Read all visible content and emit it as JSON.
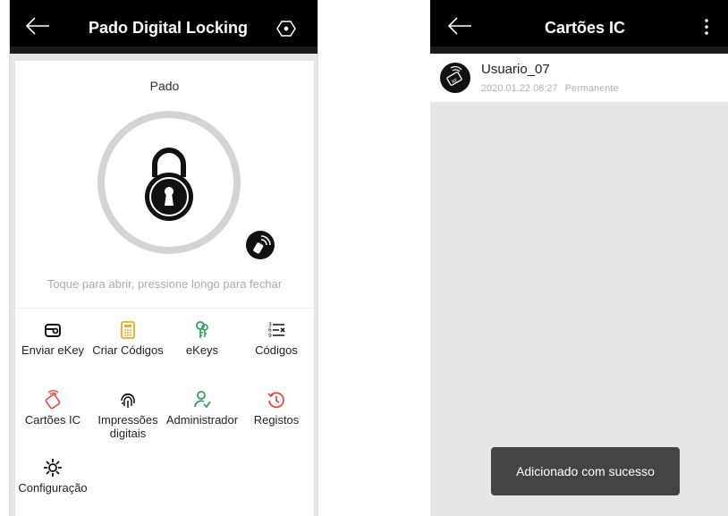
{
  "left": {
    "title": "Pado Digital Locking",
    "lock_name": "Pado",
    "hint": "Toque para abrir, pressione longo para fechar",
    "menu": [
      {
        "label": "Enviar eKey",
        "icon": "send-ekey-icon",
        "color": "#111111"
      },
      {
        "label": "Criar Códigos",
        "icon": "create-codes-icon",
        "color": "#f5a623"
      },
      {
        "label": "eKeys",
        "icon": "ekeys-icon",
        "color": "#2e9e5b"
      },
      {
        "label": "Códigos",
        "icon": "codes-icon",
        "color": "#111111"
      },
      {
        "label": "Cartões IC",
        "icon": "ic-card-icon",
        "color": "#e8463a"
      },
      {
        "label": "Impressões digitais",
        "icon": "fingerprint-icon",
        "color": "#111111"
      },
      {
        "label": "Administrador",
        "icon": "admin-icon",
        "color": "#2e9e5b"
      },
      {
        "label": "Registos",
        "icon": "records-icon",
        "color": "#e8463a"
      },
      {
        "label": "Configuração",
        "icon": "settings-icon",
        "color": "#111111"
      }
    ]
  },
  "right": {
    "title": "Cartões IC",
    "card": {
      "name": "Usuario_07",
      "date": "2020.01.22 08:27",
      "validity": "Permanente"
    },
    "toast": "Adicionado com sucesso"
  }
}
